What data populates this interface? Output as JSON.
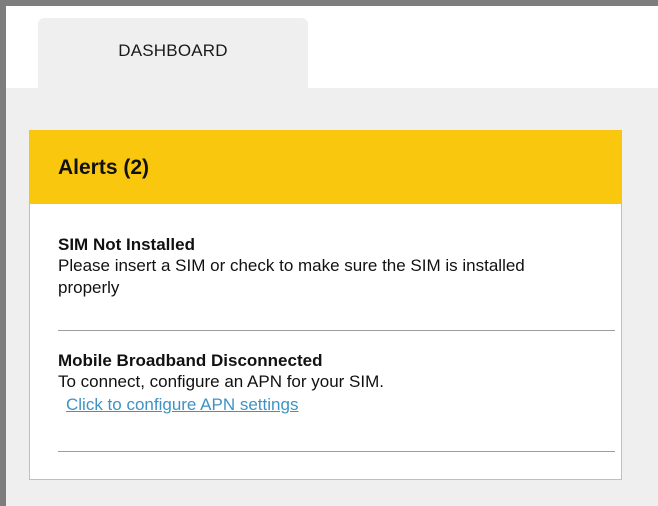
{
  "tabs": {
    "dashboard_label": "DASHBOARD"
  },
  "alerts": {
    "title": "Alerts (2)",
    "items": [
      {
        "title": "SIM Not Installed",
        "message": "Please insert a SIM or check to make sure the SIM is installed properly"
      },
      {
        "title": "Mobile Broadband Disconnected",
        "message": "To connect, configure an APN for your SIM.",
        "link": "Click to configure APN settings"
      }
    ]
  },
  "colors": {
    "accent": "#f9c80e",
    "link": "#3f93c4",
    "frame": "#7d7d7d",
    "background": "#efefef"
  }
}
